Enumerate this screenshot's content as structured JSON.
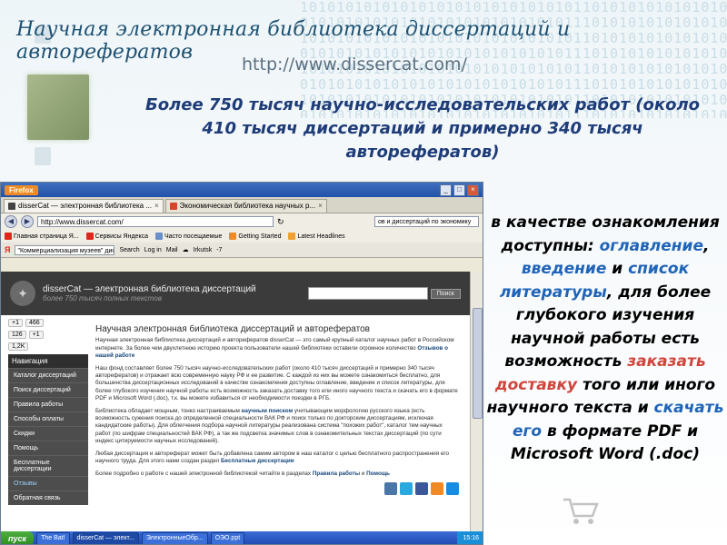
{
  "slide": {
    "title": "Научная электронная библиотека диссертаций и авторефератов",
    "url": "http://www.dissercat.com/",
    "headline": "Более 750 тысяч научно-исследовательских работ (около 410 тысяч диссертаций и примерно 340 тысяч авторефератов)",
    "side_text": {
      "part1": "в качестве ознакомления доступны: ",
      "link_toc": "оглавление",
      "comma1": ", ",
      "link_intro": "введение",
      "and1": " и ",
      "link_biblio": "список литературы",
      "part2": ", для более глубокого изучения научной работы есть возможность ",
      "link_order": "заказать доставку",
      "part3": " того или иного научного текста и ",
      "link_download": "скачать его",
      "part4": " в формате PDF и Microsoft Word (.doc)"
    },
    "binary_pattern": "1010101010101010101010101010101",
    "colors": {
      "title": "#1d5173",
      "headline": "#1e3c78",
      "link_blue": "#1f64b8",
      "link_red": "#d0443b"
    }
  },
  "browser": {
    "app": "Firefox",
    "tabs": [
      {
        "label": "disserCat — электронная библиотека ...",
        "icon": "dissercat-favicon",
        "active": true
      },
      {
        "label": "Экономическая библиотека научных р...",
        "icon": "econ-favicon",
        "active": false
      }
    ],
    "url": "http://www.dissercat.com/",
    "search_value": "ов и диссертаций по экономику",
    "bookmarks": [
      "Главная страница Я...",
      "Сервисы Яндекса",
      "Часто посещаемые",
      "Getting Started",
      "Latest Headlines"
    ],
    "yandex_bar": {
      "logo": "Я",
      "input_value": "\"Коммерциализация музеев\" дис на соис",
      "search_label": "Search",
      "login_label": "Log in",
      "mail_label": "Mail",
      "city": "Irkutsk",
      "temp": "-7"
    }
  },
  "site": {
    "name": "disserCat — электронная библиотека диссертаций",
    "tagline": "более 750 тысяч полных текстов",
    "search_button": "Поиск",
    "share_counts": {
      "gplus": "+1",
      "count_466": "466",
      "count_126": "126",
      "plus1": "+1",
      "count_12k": "1,2K"
    },
    "nav_title": "Навигация",
    "nav_items": [
      "Каталог диссертаций",
      "Поиск диссертаций",
      "Правила работы",
      "Способы оплаты",
      "Скидки",
      "Помощь",
      "Бесплатные диссертации",
      "Отзывы",
      "Обратная связь"
    ],
    "main_title": "Научная электронная библиотека диссертаций и авторефератов",
    "para1": "Научная электронная библиотека диссертаций и авторефератов disserCat — это самый крупный каталог научных работ в Российском интернете. За более чем двухлетнюю историю проекта пользователи нашей библиотеки оставили огромное количество ",
    "para1_link": "Отзывов о нашей работе",
    "para2": "Наш фонд составляет более 750 тысяч научно-исследовательских работ (около 410 тысяч диссертаций и примерно 340 тысяч авторефератов) и отражает всю современную науку РФ и ее развитие. С каждой из них вы можете ознакомиться бесплатно, для большинства диссертационных исследований в качестве ознакомления доступны оглавление, введение и список литературы, для более глубокого изучения научной работы есть возможность заказать доставку того или иного научного текста и скачать его в формате PDF и Microsoft Word (.doc), т.к. вы можете избавиться от необходимости поездки в РГБ.",
    "para3_a": "Библиотека обладает мощным, тонко настраиваемым ",
    "para3_link": "научным поиском",
    "para3_b": " учитывающим морфологию русского языка (есть возможность сужения поиска до определенной специальности ВАК РФ и поиск только по докторским диссертациям, исключая кандидатские работы). Для облегчения подбора научной литературы реализована система \"похожих работ\", каталог тем научных работ (по шифрам специальностей ВАК РФ), а так же подсветка значимых слов в ознакомительных текстах диссертаций (по сути индекс цитируемости научных исследований).",
    "para4_a": "Любая диссертация и автореферат может быть добавлена самим автором в наш каталог с целью бесплатного распространения его научного труда. Для этого нами создан раздел ",
    "para4_link": "Бесплатные диссертации",
    "para5_a": "Более подробно о работе с нашей электронной библиотекой читайте в разделах ",
    "para5_link1": "Правила работы",
    "para5_and": " и ",
    "para5_link2": "Помощь"
  },
  "taskbar": {
    "start": "пуск",
    "tasks": [
      "The Bat!",
      "disserCat — элект...",
      "ЭлектронныеОбр...",
      "ОЭО.ppt"
    ],
    "time": "15:16"
  }
}
